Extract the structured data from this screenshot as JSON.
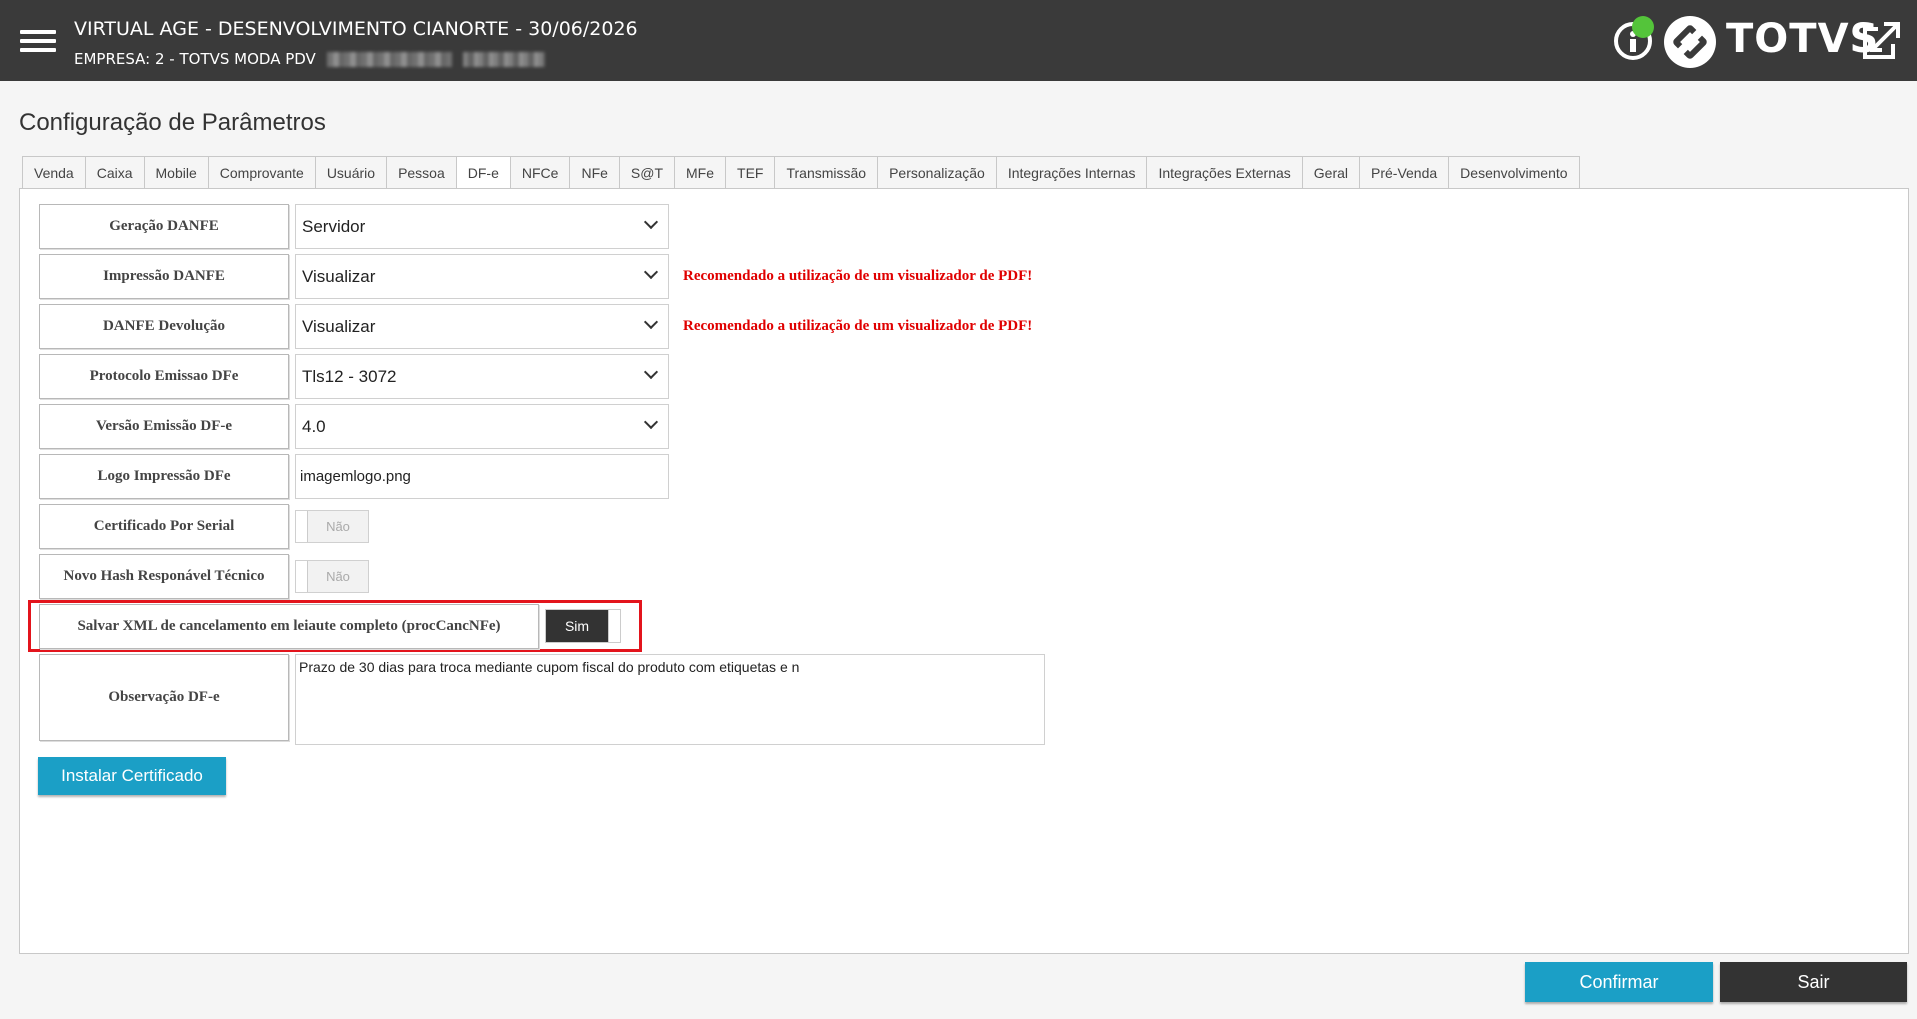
{
  "header": {
    "title": "VIRTUAL AGE - DESENVOLVIMENTO CIANORTE - 30/06/2026",
    "subtitle": "EMPRESA: 2 - TOTVS MODA PDV",
    "brand": "TOTVS",
    "status_color": "#54c43a",
    "icons": [
      "menu-icon",
      "info-icon",
      "totvs-logo-icon",
      "expand-icon"
    ]
  },
  "page": {
    "title": "Configuração de Parâmetros"
  },
  "tabs": [
    {
      "label": "Venda"
    },
    {
      "label": "Caixa"
    },
    {
      "label": "Mobile"
    },
    {
      "label": "Comprovante"
    },
    {
      "label": "Usuário"
    },
    {
      "label": "Pessoa"
    },
    {
      "label": "DF-e",
      "active": true
    },
    {
      "label": "NFCe"
    },
    {
      "label": "NFe"
    },
    {
      "label": "S@T"
    },
    {
      "label": "MFe"
    },
    {
      "label": "TEF"
    },
    {
      "label": "Transmissão"
    },
    {
      "label": "Personalização"
    },
    {
      "label": "Integrações Internas"
    },
    {
      "label": "Integrações Externas"
    },
    {
      "label": "Geral"
    },
    {
      "label": "Pré-Venda"
    },
    {
      "label": "Desenvolvimento"
    }
  ],
  "fields": {
    "geracao_danfe": {
      "label": "Geração DANFE",
      "value": "Servidor"
    },
    "impressao_danfe": {
      "label": "Impressão DANFE",
      "value": "Visualizar",
      "warning": "Recomendado a utilização de um visualizador de PDF!"
    },
    "danfe_devolucao": {
      "label": "DANFE Devolução",
      "value": "Visualizar",
      "warning": "Recomendado a utilização de um visualizador de PDF!"
    },
    "protocolo_emissao": {
      "label": "Protocolo Emissao DFe",
      "value": "Tls12 - 3072"
    },
    "versao_emissao": {
      "label": "Versão Emissão DF-e",
      "value": "4.0"
    },
    "logo_impressao": {
      "label": "Logo Impressão DFe",
      "value": "imagemlogo.png"
    },
    "certificado_serial": {
      "label": "Certificado Por Serial",
      "value": "Não"
    },
    "novo_hash": {
      "label": "Novo Hash Responável Técnico",
      "value": "Não"
    },
    "salvar_xml": {
      "label": "Salvar XML de cancelamento em leiaute completo (procCancNFe)",
      "value": "Sim"
    },
    "observacao": {
      "label": "Observação DF-e",
      "value": "Prazo de 30 dias para troca mediante cupom fiscal do produto com etiquetas e n"
    }
  },
  "buttons": {
    "instalar": "Instalar Certificado",
    "confirmar": "Confirmar",
    "sair": "Sair"
  },
  "colors": {
    "accent": "#1b9fc6",
    "header_bg": "#3a3a3a",
    "warning": "#e00000",
    "highlight": "#e3141c"
  }
}
